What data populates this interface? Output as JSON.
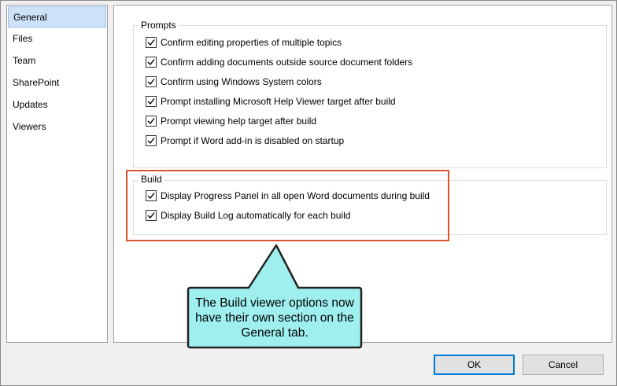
{
  "nav": {
    "items": [
      {
        "label": "General",
        "mnemonic_index": 0
      },
      {
        "label": "Files",
        "mnemonic_index": 0
      },
      {
        "label": "Team",
        "mnemonic_index": 0
      },
      {
        "label": "SharePoint",
        "mnemonic_index": 0
      },
      {
        "label": "Updates",
        "mnemonic_index": 0
      },
      {
        "label": "Viewers",
        "mnemonic_index": 0
      }
    ],
    "selected": "General"
  },
  "prompts": {
    "title": "Prompts",
    "options": [
      {
        "label": "Confirm editing properties of multiple topics",
        "checked": true
      },
      {
        "label": "Confirm adding documents outside source document folders",
        "checked": true
      },
      {
        "label": "Confirm using Windows System colors",
        "checked": true
      },
      {
        "label": "Prompt installing Microsoft Help Viewer target after build",
        "checked": true
      },
      {
        "label": "Prompt viewing help target after build",
        "checked": true
      },
      {
        "label": "Prompt if Word add-in is disabled on startup",
        "checked": true
      }
    ]
  },
  "build": {
    "title": "Build",
    "options": [
      {
        "label": "Display Progress Panel in all open Word documents during build",
        "checked": true
      },
      {
        "label": "Display Build Log automatically for each build",
        "checked": true
      }
    ]
  },
  "callout": {
    "text": "The Build viewer options now have their own section on the General tab."
  },
  "buttons": {
    "ok": "OK",
    "cancel": "Cancel"
  },
  "colors": {
    "highlight_border": "#d9532c",
    "callout_fill": "#9fefef",
    "nav_selected": "#cde1f7"
  }
}
